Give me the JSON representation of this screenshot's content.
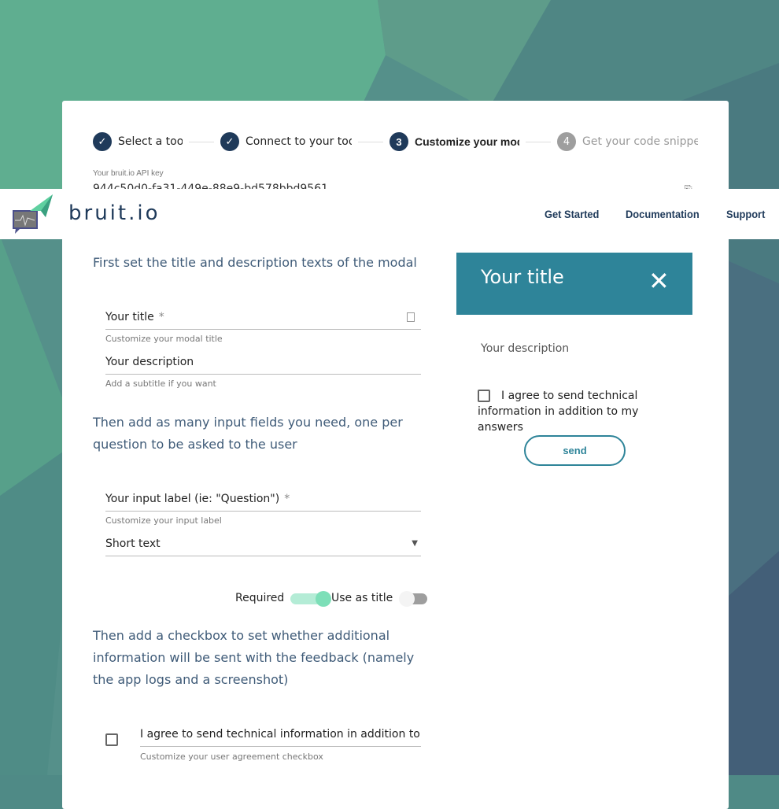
{
  "stepper": {
    "steps": [
      {
        "num": "✓",
        "label": "Select a tool",
        "state": "done"
      },
      {
        "num": "✓",
        "label": "Connect to your tool",
        "state": "done"
      },
      {
        "num": "3",
        "label": "Customize your modal",
        "state": "active"
      },
      {
        "num": "4",
        "label": "Get your code snippet",
        "state": "pending"
      }
    ]
  },
  "api_key": {
    "label": "Your bruit.io API key",
    "value": "944c50d0-fa31-449e-88e9-bd578bbd9561"
  },
  "header": {
    "brand": "bruit.io",
    "nav": [
      "Get Started",
      "Documentation",
      "Support"
    ]
  },
  "form": {
    "intro1": "First set the title and description texts of the modal",
    "title_label": "Your title",
    "title_hint": "Customize your modal title",
    "desc_label": "Your description",
    "desc_hint": "Add a subtitle if you want",
    "intro2": "Then add as many input fields you need, one per question to be asked to the user",
    "input_label": "Your input label (ie: \"Question\")",
    "input_hint": "Customize your input label",
    "type_value": "Short text",
    "required_label": "Required",
    "required_on": true,
    "use_as_title_label": "Use as title",
    "use_as_title_on": false,
    "intro3": "Then add a checkbox to set whether additional information will be sent with the feedback (namely the app logs and a screenshot)",
    "agreement_value": "I agree to send technical information in addition to my answers",
    "agreement_hint": "Customize your user agreement checkbox"
  },
  "preview": {
    "title": "Your title",
    "description": "Your description",
    "checkbox_label": "I agree to send technical information in addition to my answers",
    "send": "send",
    "accent": "#2e8499"
  }
}
